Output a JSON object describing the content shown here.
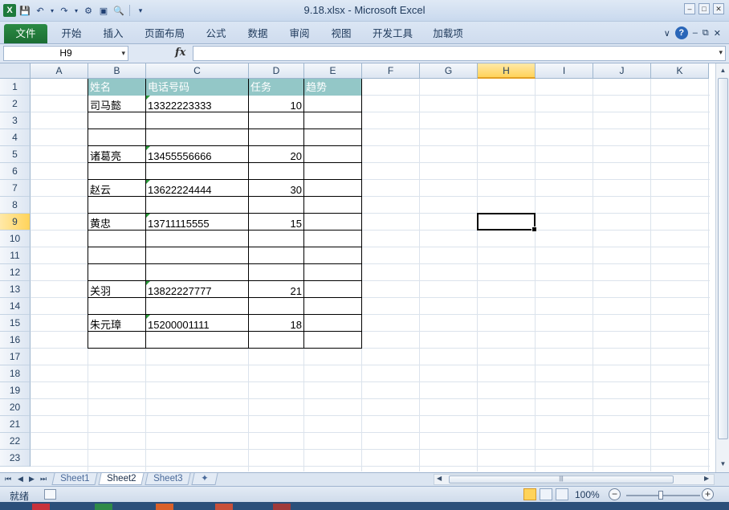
{
  "window": {
    "title": "9.18.xlsx  -  Microsoft Excel"
  },
  "ribbon": {
    "tabs": [
      "文件",
      "开始",
      "插入",
      "页面布局",
      "公式",
      "数据",
      "审阅",
      "视图",
      "开发工具",
      "加载项"
    ],
    "help_label": "?"
  },
  "formula_bar": {
    "name_box": "H9",
    "fx_label": "fx",
    "formula": ""
  },
  "columns": [
    "A",
    "B",
    "C",
    "D",
    "E",
    "F",
    "G",
    "H",
    "I",
    "J",
    "K"
  ],
  "rows": [
    "1",
    "2",
    "3",
    "4",
    "5",
    "6",
    "7",
    "8",
    "9",
    "10",
    "11",
    "12",
    "13",
    "14",
    "15",
    "16",
    "17",
    "18",
    "19",
    "20",
    "21",
    "22",
    "23"
  ],
  "selected": {
    "cell": "H9",
    "column": "H",
    "row": "9"
  },
  "table": {
    "headers": [
      "姓名",
      "电话号码",
      "任务",
      "趋势"
    ],
    "records": [
      {
        "row": 2,
        "name": "司马懿",
        "phone": "13322223333",
        "task": "10"
      },
      {
        "row": 5,
        "name": "诸葛亮",
        "phone": "13455556666",
        "task": "20"
      },
      {
        "row": 7,
        "name": "赵云",
        "phone": "13622224444",
        "task": "30"
      },
      {
        "row": 9,
        "name": "黄忠",
        "phone": "13711115555",
        "task": "15"
      },
      {
        "row": 13,
        "name": "关羽",
        "phone": "13822227777",
        "task": "21"
      },
      {
        "row": 15,
        "name": "朱元璋",
        "phone": "15200001111",
        "task": "18"
      }
    ]
  },
  "sheets": [
    {
      "name": "Sheet1",
      "active": false
    },
    {
      "name": "Sheet2",
      "active": true
    },
    {
      "name": "Sheet3",
      "active": false
    }
  ],
  "status_bar": {
    "ready": "就绪",
    "zoom": "100%",
    "zoom_minus": "−",
    "zoom_plus": "+"
  },
  "colors": {
    "header_fill": "#93c7c7",
    "file_tab": "#1c6e33",
    "selection_highlight": "#ffd35a"
  }
}
